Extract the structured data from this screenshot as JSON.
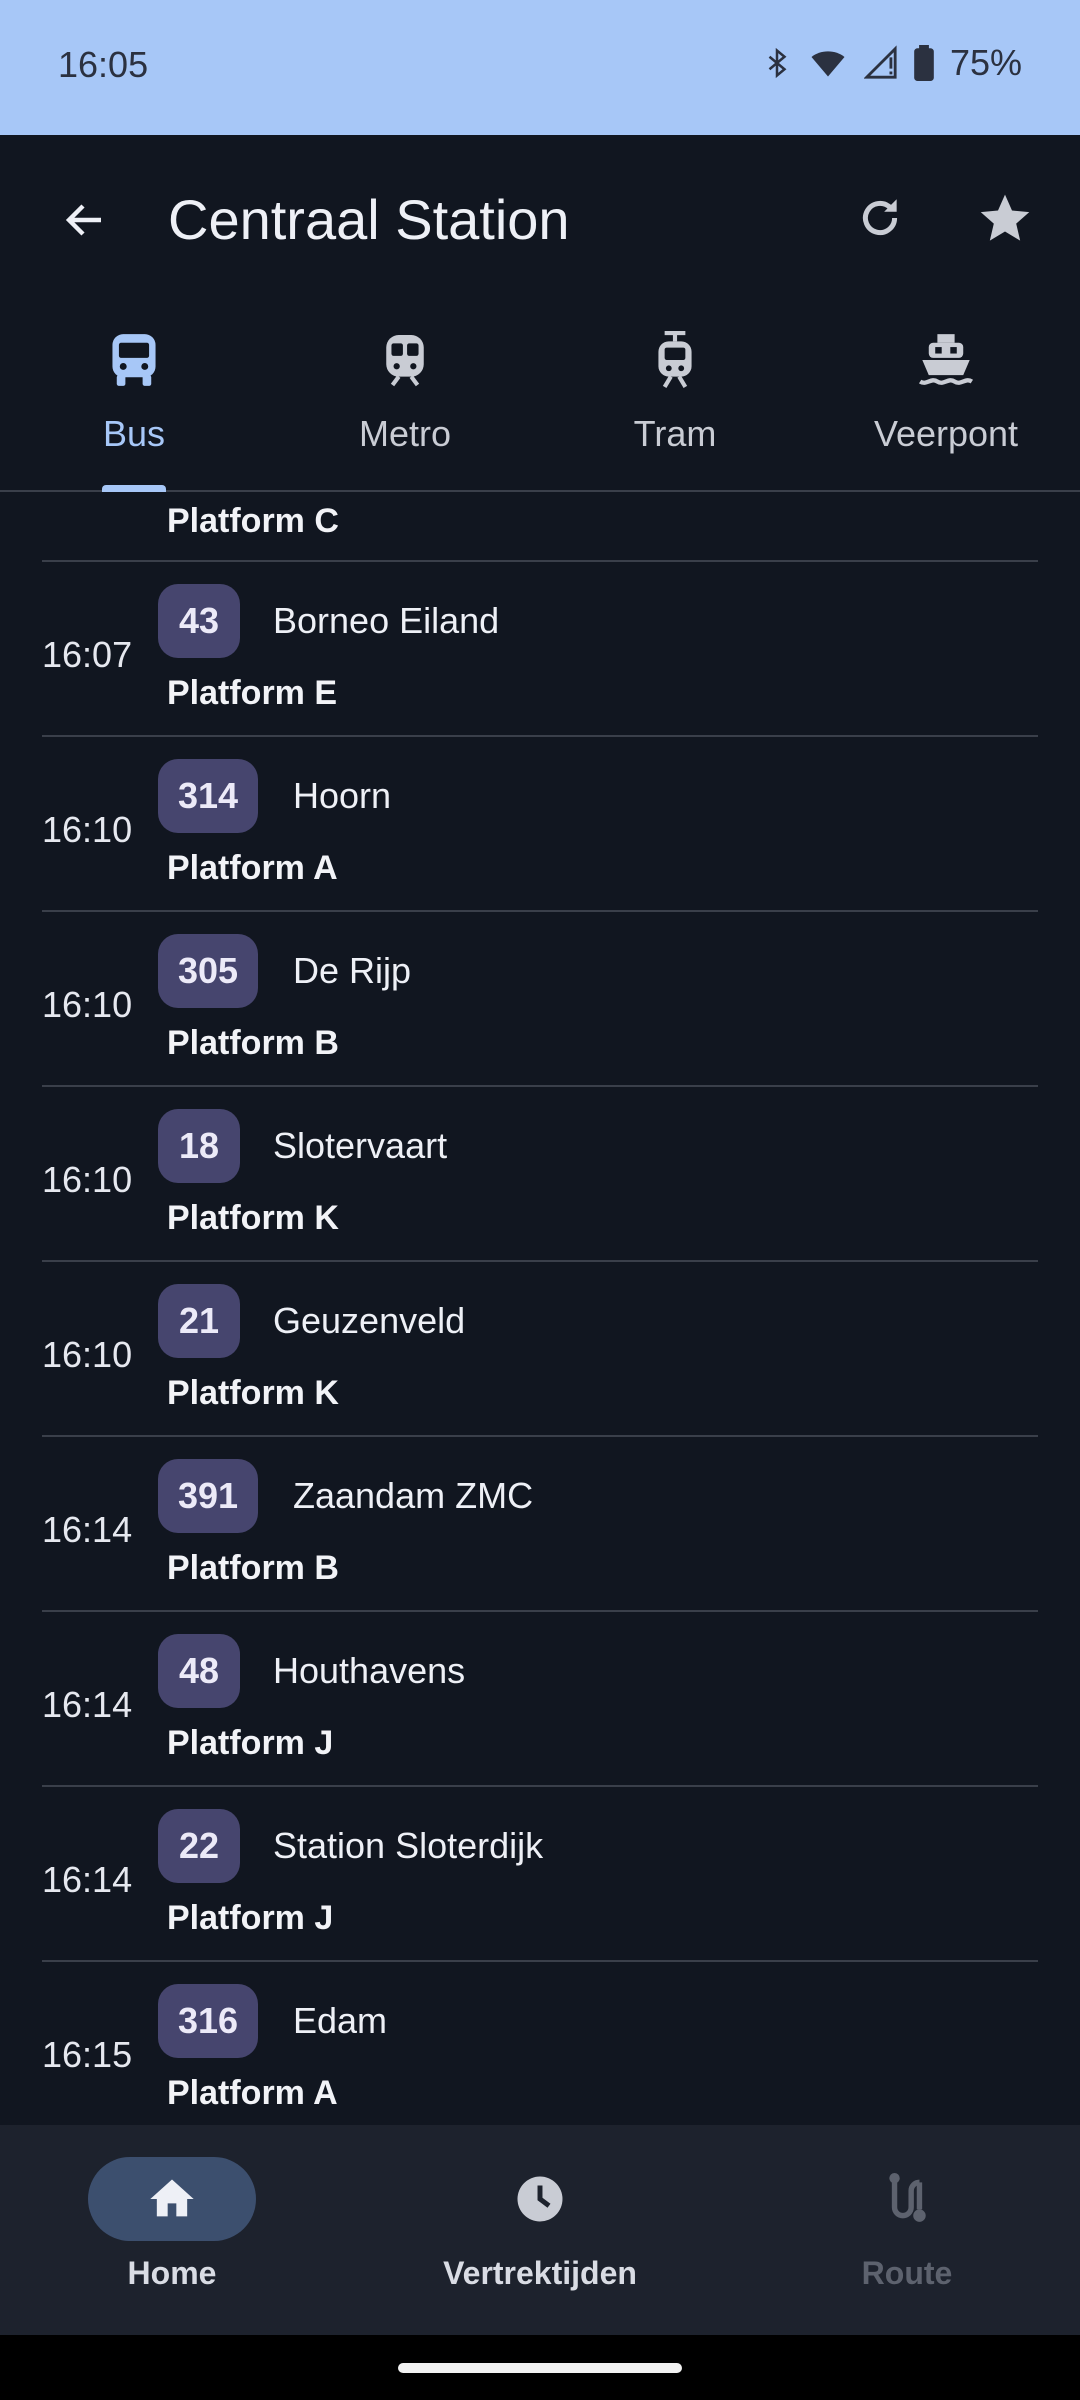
{
  "status_bar": {
    "time": "16:05",
    "battery": "75%"
  },
  "app_bar": {
    "title": "Centraal Station"
  },
  "tabs": [
    {
      "label": "Bus",
      "icon": "bus-icon",
      "active": true
    },
    {
      "label": "Metro",
      "icon": "metro-icon",
      "active": false
    },
    {
      "label": "Tram",
      "icon": "tram-icon",
      "active": false
    },
    {
      "label": "Veerpont",
      "icon": "ferry-icon",
      "active": false
    }
  ],
  "partial_row": {
    "platform": "Platform C"
  },
  "departures": [
    {
      "time": "16:07",
      "line": "43",
      "destination": "Borneo Eiland",
      "platform": "Platform E"
    },
    {
      "time": "16:10",
      "line": "314",
      "destination": "Hoorn",
      "platform": "Platform A"
    },
    {
      "time": "16:10",
      "line": "305",
      "destination": "De Rijp",
      "platform": "Platform B"
    },
    {
      "time": "16:10",
      "line": "18",
      "destination": "Slotervaart",
      "platform": "Platform K"
    },
    {
      "time": "16:10",
      "line": "21",
      "destination": "Geuzenveld",
      "platform": "Platform K"
    },
    {
      "time": "16:14",
      "line": "391",
      "destination": "Zaandam ZMC",
      "platform": "Platform B"
    },
    {
      "time": "16:14",
      "line": "48",
      "destination": "Houthavens",
      "platform": "Platform J"
    },
    {
      "time": "16:14",
      "line": "22",
      "destination": "Station Sloterdijk",
      "platform": "Platform J"
    },
    {
      "time": "16:15",
      "line": "316",
      "destination": "Edam",
      "platform": "Platform A"
    }
  ],
  "bottom_nav": [
    {
      "label": "Home",
      "icon": "home-icon",
      "active": true
    },
    {
      "label": "Vertrektijden",
      "icon": "clock-icon",
      "active": false
    },
    {
      "label": "Route",
      "icon": "route-icon",
      "active": false,
      "disabled": true
    }
  ],
  "colors": {
    "accent": "#a7c7f7",
    "background": "#111620",
    "badge": "#46456e",
    "status_bar": "#a7c7f7"
  }
}
